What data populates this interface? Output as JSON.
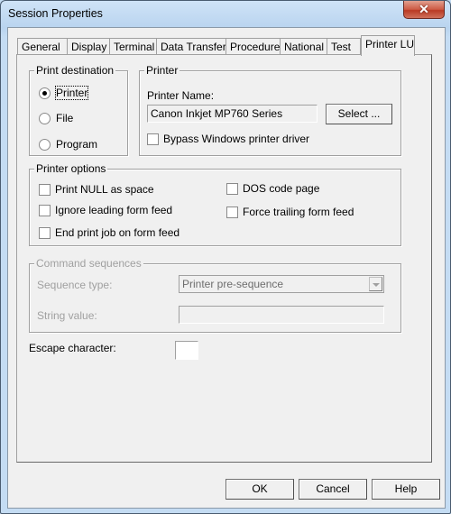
{
  "window": {
    "title": "Session Properties",
    "close_label": "✕"
  },
  "tabs": [
    {
      "label": "General",
      "active": false
    },
    {
      "label": "Display",
      "active": false
    },
    {
      "label": "Terminal",
      "active": false
    },
    {
      "label": "Data Transfer",
      "active": false
    },
    {
      "label": "Procedure",
      "active": false
    },
    {
      "label": "National",
      "active": false
    },
    {
      "label": "Test",
      "active": false
    },
    {
      "label": "Printer LU",
      "active": true
    }
  ],
  "print_destination": {
    "title": "Print destination",
    "options": [
      {
        "label": "Printer",
        "mnemonic": "P",
        "selected": true
      },
      {
        "label": "File",
        "mnemonic": "F",
        "selected": false
      },
      {
        "label": "Program",
        "mnemonic": "g",
        "selected": false
      }
    ]
  },
  "printer": {
    "title": "Printer",
    "name_label": "Printer Name:",
    "name_value": "Canon Inkjet MP760 Series",
    "select_button": "Select ...",
    "bypass_label": "Bypass Windows printer driver",
    "bypass_checked": false
  },
  "printer_options": {
    "title": "Printer options",
    "items": [
      {
        "label": "Print NULL as space",
        "checked": false
      },
      {
        "label": "Ignore leading form feed",
        "checked": false
      },
      {
        "label": "End print job on form feed",
        "checked": false
      },
      {
        "label": "DOS code page",
        "checked": false
      },
      {
        "label": "Force trailing form feed",
        "checked": false
      }
    ]
  },
  "command_sequences": {
    "title": "Command sequences",
    "sequence_type_label": "Sequence type:",
    "sequence_type_value": "Printer pre-sequence",
    "string_value_label": "String value:",
    "string_value": ""
  },
  "escape": {
    "label": "Escape character:",
    "value": ""
  },
  "buttons": {
    "ok": "OK",
    "cancel": "Cancel",
    "help": "Help"
  }
}
